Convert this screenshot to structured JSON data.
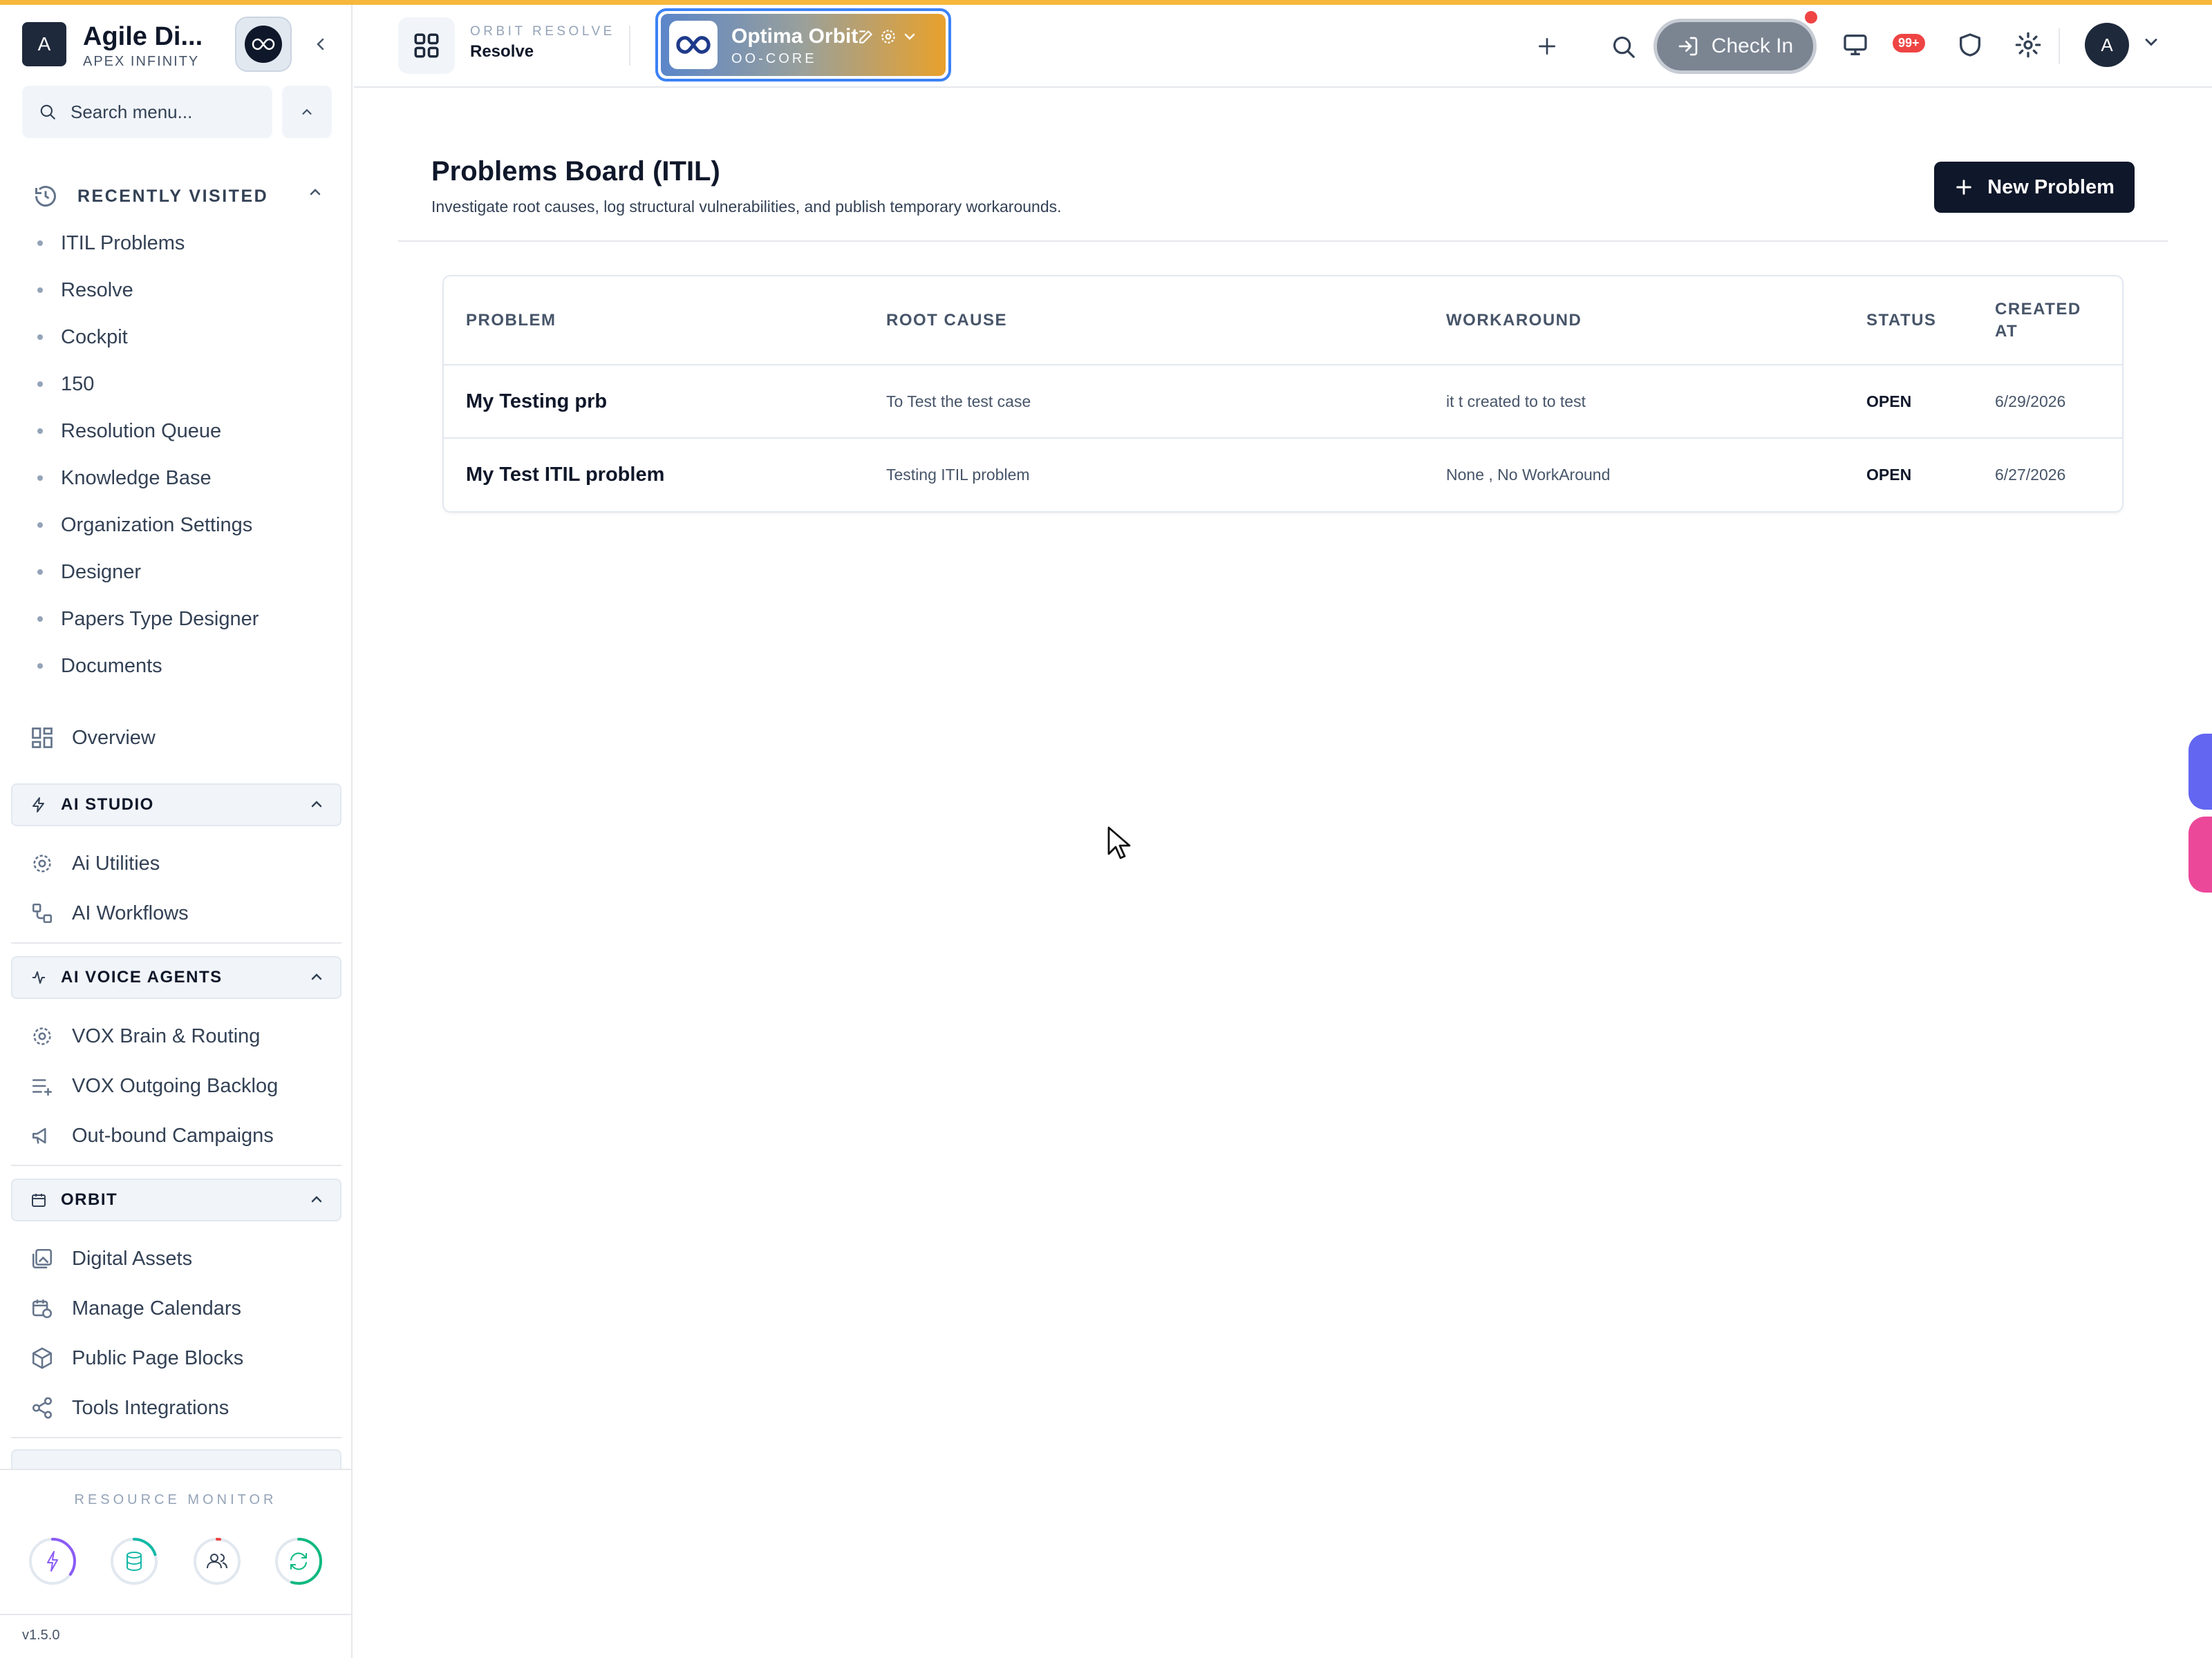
{
  "brand": {
    "initial": "A",
    "title": "Agile Di...",
    "subtitle": "APEX INFINITY"
  },
  "search": {
    "placeholder": "Search menu..."
  },
  "recent": {
    "label": "RECENTLY VISITED",
    "items": [
      "ITIL Problems",
      "Resolve",
      "Cockpit",
      "150",
      "Resolution Queue",
      "Knowledge Base",
      "Organization Settings",
      "Designer",
      "Papers Type Designer",
      "Documents"
    ]
  },
  "nav": {
    "overview": "Overview",
    "sections": [
      {
        "title": "AI STUDIO",
        "icon": "bolt-icon",
        "items": [
          {
            "label": "Ai Utilities",
            "icon": "cog-icon"
          },
          {
            "label": "AI Workflows",
            "icon": "workflow-icon"
          }
        ]
      },
      {
        "title": "AI VOICE AGENTS",
        "icon": "activity-icon",
        "items": [
          {
            "label": "VOX Brain & Routing",
            "icon": "cog-icon"
          },
          {
            "label": "VOX Outgoing Backlog",
            "icon": "list-plus-icon"
          },
          {
            "label": "Out-bound Campaigns",
            "icon": "megaphone-icon"
          }
        ]
      },
      {
        "title": "ORBIT",
        "icon": "calendar-icon",
        "items": [
          {
            "label": "Digital Assets",
            "icon": "images-icon"
          },
          {
            "label": "Manage Calendars",
            "icon": "calendar-clock-icon"
          },
          {
            "label": "Public Page Blocks",
            "icon": "box-icon"
          },
          {
            "label": "Tools Integrations",
            "icon": "share-icon"
          }
        ]
      }
    ]
  },
  "monitor": {
    "title": "RESOURCE MONITOR",
    "gauges": [
      {
        "icon": "bolt-icon",
        "color": "#8b5cf6",
        "level": 0.35
      },
      {
        "icon": "database-icon",
        "color": "#14b8a6",
        "level": 0.2
      },
      {
        "icon": "users-icon",
        "color": "#ef4444",
        "level": 0.02
      },
      {
        "icon": "refresh-icon",
        "color": "#10b981",
        "level": 0.55
      }
    ]
  },
  "version": "v1.5.0",
  "header": {
    "app_label": "ORBIT RESOLVE",
    "app_name": "Resolve",
    "workspace_name": "Optima Orbit",
    "workspace_code": "OO-CORE",
    "checkin_label": "Check In",
    "notif_count": "99+",
    "avatar_initial": "A"
  },
  "page": {
    "title": "Problems Board (ITIL)",
    "subtitle": "Investigate root causes, log structural vulnerabilities, and publish temporary workarounds.",
    "new_button": "New Problem"
  },
  "table": {
    "columns": [
      "PROBLEM",
      "ROOT CAUSE",
      "WORKAROUND",
      "STATUS",
      "CREATED AT"
    ],
    "rows": [
      {
        "problem": "My Testing prb",
        "root_cause": "To Test the test case",
        "workaround": "it t created to to test",
        "status": "OPEN",
        "created_at": "6/29/2026"
      },
      {
        "problem": "My Test ITIL problem",
        "root_cause": "Testing ITIL problem",
        "workaround": "None , No WorkAround",
        "status": "OPEN",
        "created_at": "6/27/2026"
      }
    ]
  },
  "colors": {
    "accent_top": "#f6b73c",
    "primary_button": "#0f172a",
    "workspace_border": "#3b82f6",
    "badge": "#ef4444"
  }
}
